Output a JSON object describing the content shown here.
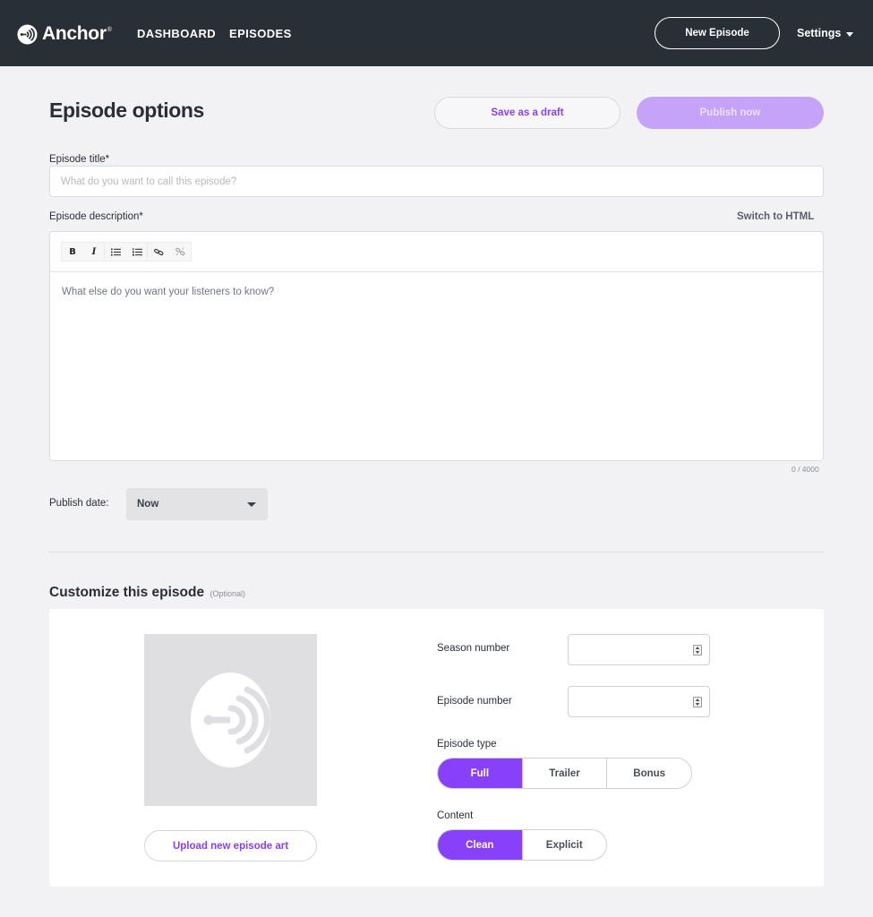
{
  "nav": {
    "logo_text": "Anchor",
    "logo_mark": "®",
    "links": [
      "DASHBOARD",
      "EPISODES"
    ],
    "new_episode": "New Episode",
    "settings": "Settings"
  },
  "header": {
    "title": "Episode options",
    "save_draft": "Save as a draft",
    "publish_now": "Publish now"
  },
  "form": {
    "title_label": "Episode title*",
    "title_placeholder": "What do you want to call this episode?",
    "title_value": "",
    "description_label": "Episode description*",
    "switch_html": "Switch to HTML",
    "toolbar": [
      "bold-icon",
      "italic-icon",
      "bullet-list-icon",
      "numbered-list-icon",
      "link-icon",
      "unlink-icon"
    ],
    "toolbar_glyphs": {
      "bold": "B",
      "italic": "I"
    },
    "description_placeholder": "What else do you want your listeners to know?",
    "char_count": "0 / 4000",
    "publish_date_label": "Publish date:",
    "publish_date_value": "Now"
  },
  "customize": {
    "title": "Customize this episode",
    "optional": "(Optional)",
    "upload_art": "Upload new episode art",
    "season_label": "Season number",
    "season_value": "",
    "episode_number_label": "Episode number",
    "episode_number_value": "",
    "episode_type_label": "Episode type",
    "episode_types": [
      "Full",
      "Trailer",
      "Bonus"
    ],
    "episode_type_selected": "Full",
    "content_label": "Content",
    "content_options": [
      "Clean",
      "Explicit"
    ],
    "content_selected": "Clean"
  },
  "colors": {
    "nav_bg": "#292f36",
    "accent": "#8940fa",
    "accent_disabled": "#c4a3f9",
    "page_bg": "#f2f2f4"
  }
}
